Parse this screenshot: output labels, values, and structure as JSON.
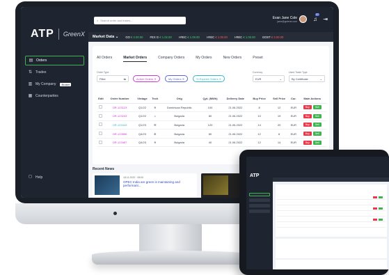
{
  "app": {
    "logo": "ATP",
    "logo_suffix": "GreenX"
  },
  "sidebar": {
    "items": [
      {
        "label": "Orders",
        "icon": "orders-icon",
        "active": true
      },
      {
        "label": "Trades",
        "icon": "trades-icon",
        "active": false
      },
      {
        "label": "My Company",
        "icon": "company-icon",
        "active": false,
        "tag": "Broker"
      },
      {
        "label": "Counterparties",
        "icon": "counterparties-icon",
        "active": false
      }
    ],
    "help_label": "Help"
  },
  "topbar": {
    "search_placeholder": "Search order and trades...",
    "user_name": "Evan Jane Cole",
    "user_email": "jane@greenx.com",
    "notification_count": "27"
  },
  "ticker": {
    "label": "Market Data",
    "items": [
      {
        "name": "GO",
        "price": "€ 2.00.00",
        "dir": "up"
      },
      {
        "name": "FEX G",
        "price": "€ 1.02.00",
        "dir": "up"
      },
      {
        "name": "I-REC",
        "price": "€ 1.00.00",
        "dir": "up"
      },
      {
        "name": "I-REC",
        "price": "€ 1.00.00",
        "dir": "down"
      },
      {
        "name": "I-REC",
        "price": "€ 1.00.00",
        "dir": "up"
      },
      {
        "name": "GOST",
        "price": "€ 3.00.00",
        "dir": "down"
      }
    ]
  },
  "tabs": [
    {
      "label": "All Orders",
      "active": false
    },
    {
      "label": "Market Orders",
      "active": true
    },
    {
      "label": "Company Orders",
      "active": false
    },
    {
      "label": "My Orders",
      "active": false
    },
    {
      "label": "New Orders",
      "active": false
    },
    {
      "label": "Preset",
      "active": false
    }
  ],
  "filters": {
    "order_type_label": "Order Type",
    "order_type_value": "Filter",
    "chips": [
      "Active Orders",
      "My Orders",
      "% Expired Orders"
    ],
    "currency_label": "Currency",
    "currency_value": "EUR",
    "trade_type_label": "Used Trade Type",
    "trade_type_value": "By Certificate"
  },
  "table": {
    "columns": [
      "Edit",
      "Order Number",
      "Vintage",
      "Tech",
      "Orig",
      "Qyt. (MWh)",
      "Delivery Date",
      "Buy Price",
      "Sell Price",
      "Cur.",
      "Main Actions"
    ],
    "rows": [
      {
        "order": "OR-123123",
        "vintage": "Q1/22",
        "tech": "hydro-icon",
        "orig": "Dominican Republic",
        "qty": "100",
        "date": "21.06.2022",
        "buy": "8",
        "sell": "12",
        "cur": "EUR"
      },
      {
        "order": "OR-123243",
        "vintage": "Q1/22",
        "tech": "solar-icon",
        "orig": "Bulgaria",
        "qty": "80",
        "date": "21.06.2022",
        "buy": "10",
        "sell": "19",
        "cur": "EUR"
      },
      {
        "order": "OR-123443",
        "vintage": "Q1/23",
        "tech": "wind-icon",
        "orig": "Bulgaria",
        "qty": "120",
        "date": "21.06.2022",
        "buy": "14",
        "sell": "20",
        "cur": "EUR"
      },
      {
        "order": "OR-123556",
        "vintage": "Q4/23",
        "tech": "biomass-icon",
        "orig": "Bulgaria",
        "qty": "80",
        "date": "21.06.2022",
        "buy": "12",
        "sell": "8",
        "cur": "EUR"
      },
      {
        "order": "OR-123487",
        "vintage": "Q4/23",
        "tech": "hydro-icon",
        "orig": "Bulgaria",
        "qty": "40",
        "date": "21.06.2022",
        "buy": "12",
        "sell": "14",
        "cur": "EUR"
      }
    ],
    "buy_label": "Buy",
    "sell_label": "Sell"
  },
  "news": {
    "title": "Recent News",
    "date": "18.11.2022 · 08:00",
    "headline": "OPEC India are green is maintaining and performant..."
  },
  "colors": {
    "sidebar": "#1f2530",
    "accent_green": "#3fb34f",
    "buy_red": "#e83a4a",
    "link_magenta": "#c93ad0"
  }
}
